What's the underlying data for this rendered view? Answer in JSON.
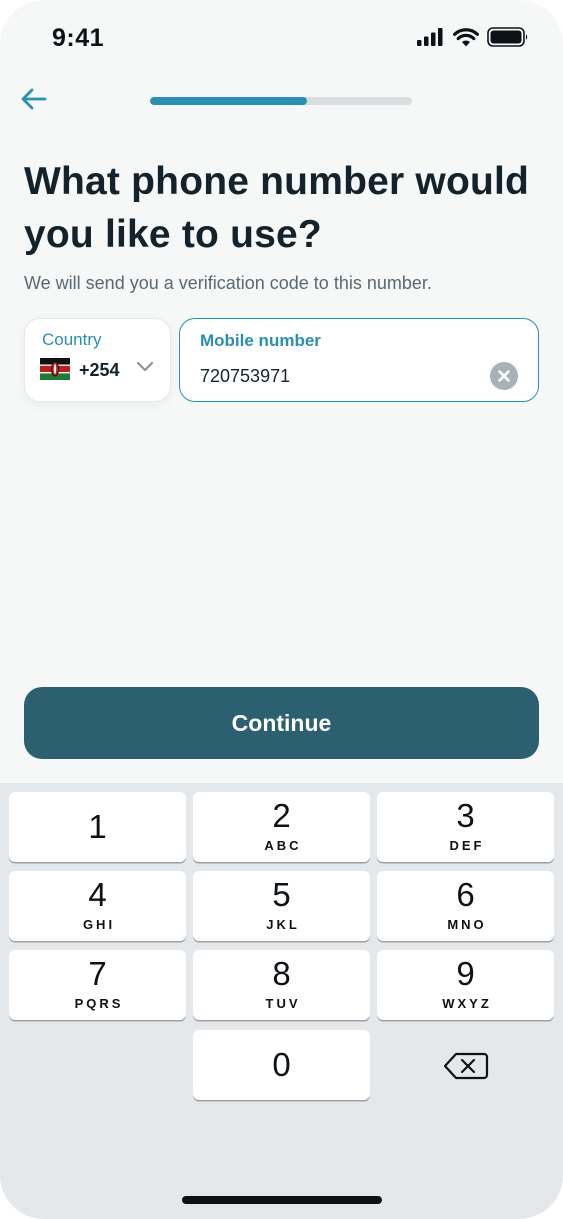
{
  "status_bar": {
    "time": "9:41"
  },
  "header": {
    "progress_fraction": 0.6
  },
  "title": "What phone number would you like to use?",
  "subtitle": "We will send you a verification code to this number.",
  "country": {
    "label": "Country",
    "dial_code": "+254",
    "flag": "kenya-flag-icon"
  },
  "mobile": {
    "label": "Mobile number",
    "value": "720753971"
  },
  "continue_label": "Continue",
  "keypad": {
    "keys": [
      {
        "digit": "1",
        "letters": ""
      },
      {
        "digit": "2",
        "letters": "ABC"
      },
      {
        "digit": "3",
        "letters": "DEF"
      },
      {
        "digit": "4",
        "letters": "GHI"
      },
      {
        "digit": "5",
        "letters": "JKL"
      },
      {
        "digit": "6",
        "letters": "MNO"
      },
      {
        "digit": "7",
        "letters": "PQRS"
      },
      {
        "digit": "8",
        "letters": "TUV"
      },
      {
        "digit": "9",
        "letters": "WXYZ"
      },
      {
        "digit": "0",
        "letters": ""
      }
    ]
  },
  "colors": {
    "accent": "#2b8fb3",
    "button": "#2c6070",
    "title": "#14222b",
    "keypad_bg": "#e5e8ea"
  }
}
